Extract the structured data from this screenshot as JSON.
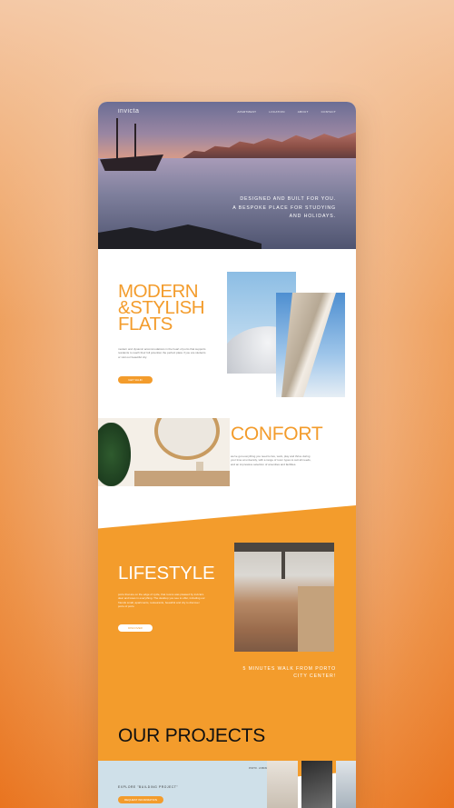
{
  "brand": "invicta",
  "nav": [
    "APARTMENT",
    "LOCATION",
    "ABOUT",
    "CONTACT"
  ],
  "hero": {
    "line1": "DESIGNED AND BUILT FOR YOU.",
    "line2": "A BESPOKE PLACE FOR STUDYING",
    "line3": "AND HOLIDAYS."
  },
  "modern": {
    "title_line1": "MODERN",
    "title_line2": "&STYLISH",
    "title_line3": "FLATS",
    "body": "modern and dynamic accommodations in the heart of porto that supports residents to reach their full potential, the perfect place if you are students or visit our beautiful city.",
    "button": "GET VALID"
  },
  "confort": {
    "title": "CONFORT",
    "body": "we've got everything you need to live, work, play and thrive during your time at university, with a range of room types to suit all needs, and an impressive selection of amenities and facilities."
  },
  "lifestyle": {
    "title": "LIFESTYLE",
    "body": "porto that are on the edge of cycle, that rooms was pleased by invicta's dear and loses in everything. The desktop you see to offer, including our friends small, apartments, restaurants, beautiful and city to discover porto of porto",
    "button": "DISCOVER",
    "caption_line1": "5 MINUTES WALK FROM PORTO",
    "caption_line2": "CITY CENTER!"
  },
  "projects": {
    "title": "OUR PROJECTS",
    "label": "EXPLORE \"BUILDING PROJECT\"",
    "button": "REQUEST INFORMATION",
    "small": "PORTO · LISBON"
  },
  "colors": {
    "accent": "#f39c2c",
    "background_outer": "#ec8d3f"
  }
}
